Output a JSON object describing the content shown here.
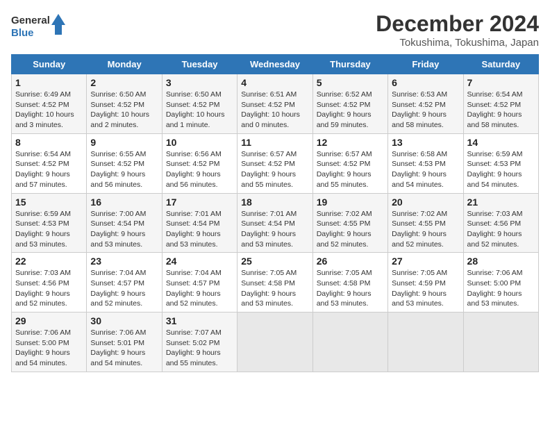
{
  "logo": {
    "line1": "General",
    "line2": "Blue"
  },
  "title": "December 2024",
  "subtitle": "Tokushima, Tokushima, Japan",
  "days_of_week": [
    "Sunday",
    "Monday",
    "Tuesday",
    "Wednesday",
    "Thursday",
    "Friday",
    "Saturday"
  ],
  "weeks": [
    [
      {
        "day": "1",
        "info": "Sunrise: 6:49 AM\nSunset: 4:52 PM\nDaylight: 10 hours\nand 3 minutes."
      },
      {
        "day": "2",
        "info": "Sunrise: 6:50 AM\nSunset: 4:52 PM\nDaylight: 10 hours\nand 2 minutes."
      },
      {
        "day": "3",
        "info": "Sunrise: 6:50 AM\nSunset: 4:52 PM\nDaylight: 10 hours\nand 1 minute."
      },
      {
        "day": "4",
        "info": "Sunrise: 6:51 AM\nSunset: 4:52 PM\nDaylight: 10 hours\nand 0 minutes."
      },
      {
        "day": "5",
        "info": "Sunrise: 6:52 AM\nSunset: 4:52 PM\nDaylight: 9 hours\nand 59 minutes."
      },
      {
        "day": "6",
        "info": "Sunrise: 6:53 AM\nSunset: 4:52 PM\nDaylight: 9 hours\nand 58 minutes."
      },
      {
        "day": "7",
        "info": "Sunrise: 6:54 AM\nSunset: 4:52 PM\nDaylight: 9 hours\nand 58 minutes."
      }
    ],
    [
      {
        "day": "8",
        "info": "Sunrise: 6:54 AM\nSunset: 4:52 PM\nDaylight: 9 hours\nand 57 minutes."
      },
      {
        "day": "9",
        "info": "Sunrise: 6:55 AM\nSunset: 4:52 PM\nDaylight: 9 hours\nand 56 minutes."
      },
      {
        "day": "10",
        "info": "Sunrise: 6:56 AM\nSunset: 4:52 PM\nDaylight: 9 hours\nand 56 minutes."
      },
      {
        "day": "11",
        "info": "Sunrise: 6:57 AM\nSunset: 4:52 PM\nDaylight: 9 hours\nand 55 minutes."
      },
      {
        "day": "12",
        "info": "Sunrise: 6:57 AM\nSunset: 4:52 PM\nDaylight: 9 hours\nand 55 minutes."
      },
      {
        "day": "13",
        "info": "Sunrise: 6:58 AM\nSunset: 4:53 PM\nDaylight: 9 hours\nand 54 minutes."
      },
      {
        "day": "14",
        "info": "Sunrise: 6:59 AM\nSunset: 4:53 PM\nDaylight: 9 hours\nand 54 minutes."
      }
    ],
    [
      {
        "day": "15",
        "info": "Sunrise: 6:59 AM\nSunset: 4:53 PM\nDaylight: 9 hours\nand 53 minutes."
      },
      {
        "day": "16",
        "info": "Sunrise: 7:00 AM\nSunset: 4:54 PM\nDaylight: 9 hours\nand 53 minutes."
      },
      {
        "day": "17",
        "info": "Sunrise: 7:01 AM\nSunset: 4:54 PM\nDaylight: 9 hours\nand 53 minutes."
      },
      {
        "day": "18",
        "info": "Sunrise: 7:01 AM\nSunset: 4:54 PM\nDaylight: 9 hours\nand 53 minutes."
      },
      {
        "day": "19",
        "info": "Sunrise: 7:02 AM\nSunset: 4:55 PM\nDaylight: 9 hours\nand 52 minutes."
      },
      {
        "day": "20",
        "info": "Sunrise: 7:02 AM\nSunset: 4:55 PM\nDaylight: 9 hours\nand 52 minutes."
      },
      {
        "day": "21",
        "info": "Sunrise: 7:03 AM\nSunset: 4:56 PM\nDaylight: 9 hours\nand 52 minutes."
      }
    ],
    [
      {
        "day": "22",
        "info": "Sunrise: 7:03 AM\nSunset: 4:56 PM\nDaylight: 9 hours\nand 52 minutes."
      },
      {
        "day": "23",
        "info": "Sunrise: 7:04 AM\nSunset: 4:57 PM\nDaylight: 9 hours\nand 52 minutes."
      },
      {
        "day": "24",
        "info": "Sunrise: 7:04 AM\nSunset: 4:57 PM\nDaylight: 9 hours\nand 52 minutes."
      },
      {
        "day": "25",
        "info": "Sunrise: 7:05 AM\nSunset: 4:58 PM\nDaylight: 9 hours\nand 53 minutes."
      },
      {
        "day": "26",
        "info": "Sunrise: 7:05 AM\nSunset: 4:58 PM\nDaylight: 9 hours\nand 53 minutes."
      },
      {
        "day": "27",
        "info": "Sunrise: 7:05 AM\nSunset: 4:59 PM\nDaylight: 9 hours\nand 53 minutes."
      },
      {
        "day": "28",
        "info": "Sunrise: 7:06 AM\nSunset: 5:00 PM\nDaylight: 9 hours\nand 53 minutes."
      }
    ],
    [
      {
        "day": "29",
        "info": "Sunrise: 7:06 AM\nSunset: 5:00 PM\nDaylight: 9 hours\nand 54 minutes."
      },
      {
        "day": "30",
        "info": "Sunrise: 7:06 AM\nSunset: 5:01 PM\nDaylight: 9 hours\nand 54 minutes."
      },
      {
        "day": "31",
        "info": "Sunrise: 7:07 AM\nSunset: 5:02 PM\nDaylight: 9 hours\nand 55 minutes."
      },
      {
        "day": "",
        "info": ""
      },
      {
        "day": "",
        "info": ""
      },
      {
        "day": "",
        "info": ""
      },
      {
        "day": "",
        "info": ""
      }
    ]
  ]
}
